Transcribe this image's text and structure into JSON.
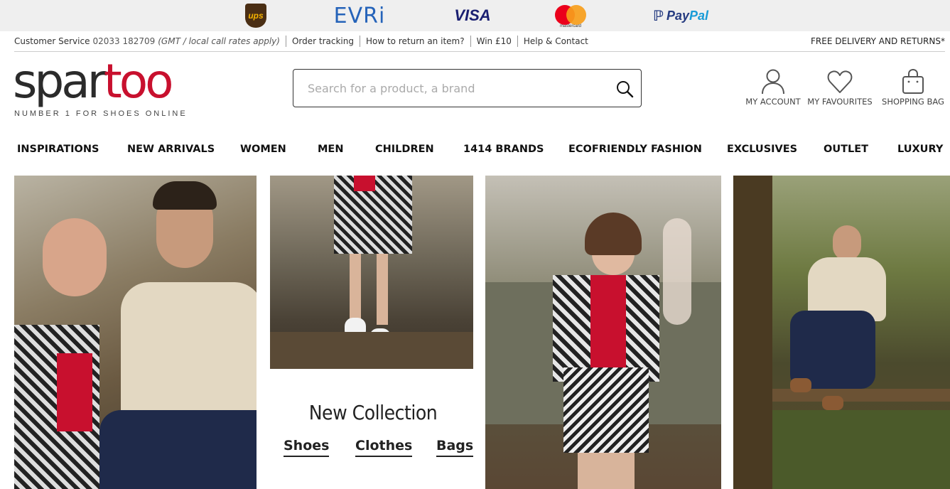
{
  "payment_logos": {
    "ups": "ups",
    "evri": "EVRi",
    "visa": "VISA",
    "mastercard": "mastercard",
    "paypal_1": "Pay",
    "paypal_2": "Pal"
  },
  "utility": {
    "customer_service_label": "Customer Service",
    "customer_service_phone": "02033 182709",
    "customer_service_note": "(GMT / local call rates apply)",
    "links": [
      "Order tracking",
      "How to return an item?",
      "Win £10",
      "Help & Contact"
    ],
    "free_delivery": "FREE DELIVERY AND RETURNS*"
  },
  "header": {
    "logo_part1": "spar",
    "logo_part2": "too",
    "tagline": "NUMBER 1 FOR SHOES ONLINE",
    "search_placeholder": "Search for a product, a brand",
    "account_label": "MY ACCOUNT",
    "favourites_label": "MY FAVOURITES",
    "bag_label": "SHOPPING BAG"
  },
  "nav": {
    "items": [
      "INSPIRATIONS",
      "NEW ARRIVALS",
      "WOMEN",
      "MEN",
      "CHILDREN",
      "1414 BRANDS",
      "ECOFRIENDLY FASHION",
      "EXCLUSIVES",
      "OUTLET",
      "LUXURY"
    ]
  },
  "collection": {
    "title": "New Collection",
    "links": [
      "Shoes",
      "Clothes",
      "Bags"
    ]
  },
  "colors": {
    "brand_red": "#c8102e",
    "text_dark": "#222222",
    "paybar_bg": "#efefef"
  }
}
